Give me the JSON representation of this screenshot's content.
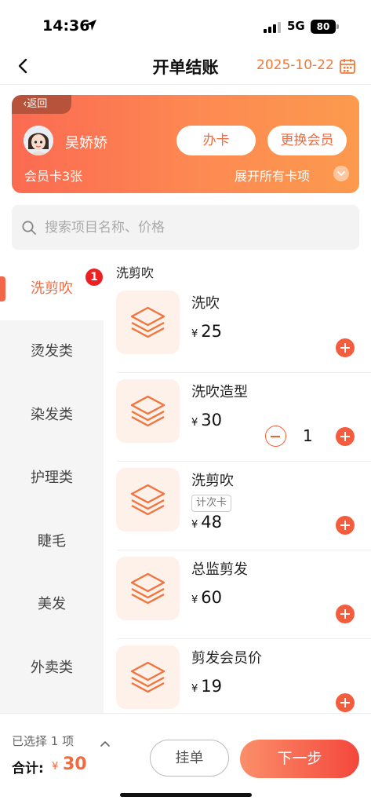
{
  "status_bar": {
    "time": "14:36",
    "network": "5G",
    "battery": "80"
  },
  "nav": {
    "title": "开单结账",
    "date": "2025-10-22"
  },
  "member": {
    "back_label": "返回",
    "name": "吴娇娇",
    "open_card_label": "办卡",
    "switch_member_label": "更换会员",
    "card_count": "会员卡3张",
    "expand_label": "展开所有卡项"
  },
  "search": {
    "placeholder": "搜索项目名称、价格"
  },
  "categories": [
    {
      "label": "洗剪吹",
      "active": true,
      "badge": "1"
    },
    {
      "label": "烫发类"
    },
    {
      "label": "染发类"
    },
    {
      "label": "护理类"
    },
    {
      "label": "睫毛"
    },
    {
      "label": "美发"
    },
    {
      "label": "外卖类"
    }
  ],
  "section_title": "洗剪吹",
  "products": [
    {
      "name": "洗吹",
      "currency": "¥",
      "price": "25"
    },
    {
      "name": "洗吹造型",
      "currency": "¥",
      "price": "30",
      "quantity": "1"
    },
    {
      "name": "洗剪吹",
      "tag": "计次卡",
      "currency": "¥",
      "price": "48"
    },
    {
      "name": "总监剪发",
      "currency": "¥",
      "price": "60"
    },
    {
      "name": "剪发会员价",
      "currency": "¥",
      "price": "19"
    }
  ],
  "bottom": {
    "selected_count": "已选择 1 项",
    "total_label": "合计:",
    "currency": "¥",
    "total_value": "30",
    "hold_label": "挂单",
    "next_label": "下一步"
  },
  "colors": {
    "accent": "#f26a3e",
    "badge": "#ec2020",
    "thumb_bg": "#fef1ea"
  }
}
